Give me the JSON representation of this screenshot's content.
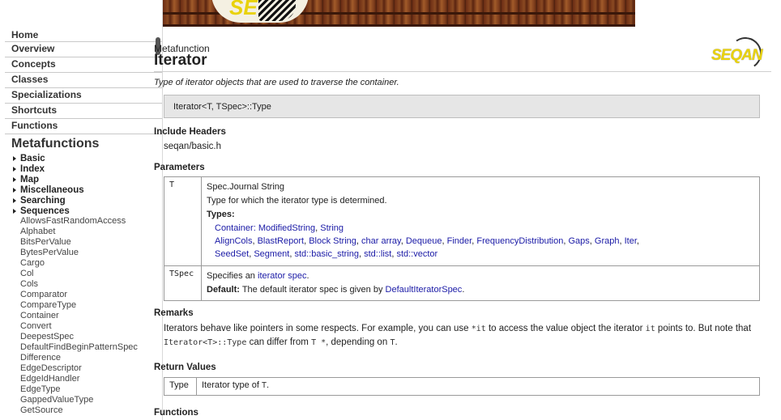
{
  "sidebar": {
    "nav": [
      "Home",
      "Overview",
      "Concepts",
      "Classes",
      "Specializations",
      "Shortcuts",
      "Functions"
    ],
    "section_title": "Metafunctions",
    "groups": [
      "Basic",
      "Index",
      "Map",
      "Miscellaneous",
      "Searching",
      "Sequences"
    ],
    "items": [
      "AllowsFastRandomAccess",
      "Alphabet",
      "BitsPerValue",
      "BytesPerValue",
      "Cargo",
      "Col",
      "Cols",
      "Comparator",
      "CompareType",
      "Container",
      "Convert",
      "DeepestSpec",
      "DefaultFindBeginPatternSpec",
      "Difference",
      "EdgeDescriptor",
      "EdgeIdHandler",
      "EdgeType",
      "GappedValueType",
      "GetSource"
    ]
  },
  "banner": {
    "logo_text": "SEQ"
  },
  "page": {
    "kind": "Metafunction",
    "title": "Iterator",
    "logo_text": "SEQAN",
    "summary": "Type of iterator objects that are used to traverse the container.",
    "signature": "Iterator<T, TSpec>::Type",
    "include_heading": "Include Headers",
    "include_value": "seqan/basic.h",
    "params_heading": "Parameters",
    "params": {
      "t": {
        "name": "T",
        "type": "Spec.Journal String",
        "desc": "Type for which the iterator type is determined.",
        "types_label": "Types:",
        "types_line1_prefix": "Container:",
        "types_line1_links": [
          "ModifiedString",
          "String"
        ],
        "types_line2_links": [
          "AlignCols",
          "BlastReport",
          "Block String",
          "char array",
          "Dequeue",
          "Finder",
          "FrequencyDistribution",
          "Gaps",
          "Graph",
          "Iter"
        ],
        "types_line3_links": [
          "SeedSet",
          "Segment",
          "std::basic_string",
          "std::list",
          "std::vector"
        ]
      },
      "tspec": {
        "name": "TSpec",
        "desc_prefix": "Specifies an",
        "desc_link": "iterator spec",
        "desc_suffix": ".",
        "default_label": "Default:",
        "default_prefix": "The default iterator spec is given by",
        "default_link": "DefaultIteratorSpec",
        "default_suffix": "."
      }
    },
    "remarks_heading": "Remarks",
    "remarks": {
      "p1": "Iterators behave like pointers in some respects. For example, you can use",
      "c1": "*it",
      "p2": "to access the value object the iterator",
      "c2": "it",
      "p3": "points",
      "p4": "to. But note that",
      "c3": "Iterator<T>::Type",
      "p5": "can differ from",
      "c4": "T *",
      "p6": ", depending on",
      "c5": "T",
      "p7": "."
    },
    "return_heading": "Return Values",
    "return": {
      "type": "Type",
      "desc_prefix": "Iterator type of",
      "desc_code": "T",
      "desc_suffix": "."
    },
    "functions_heading": "Functions"
  }
}
